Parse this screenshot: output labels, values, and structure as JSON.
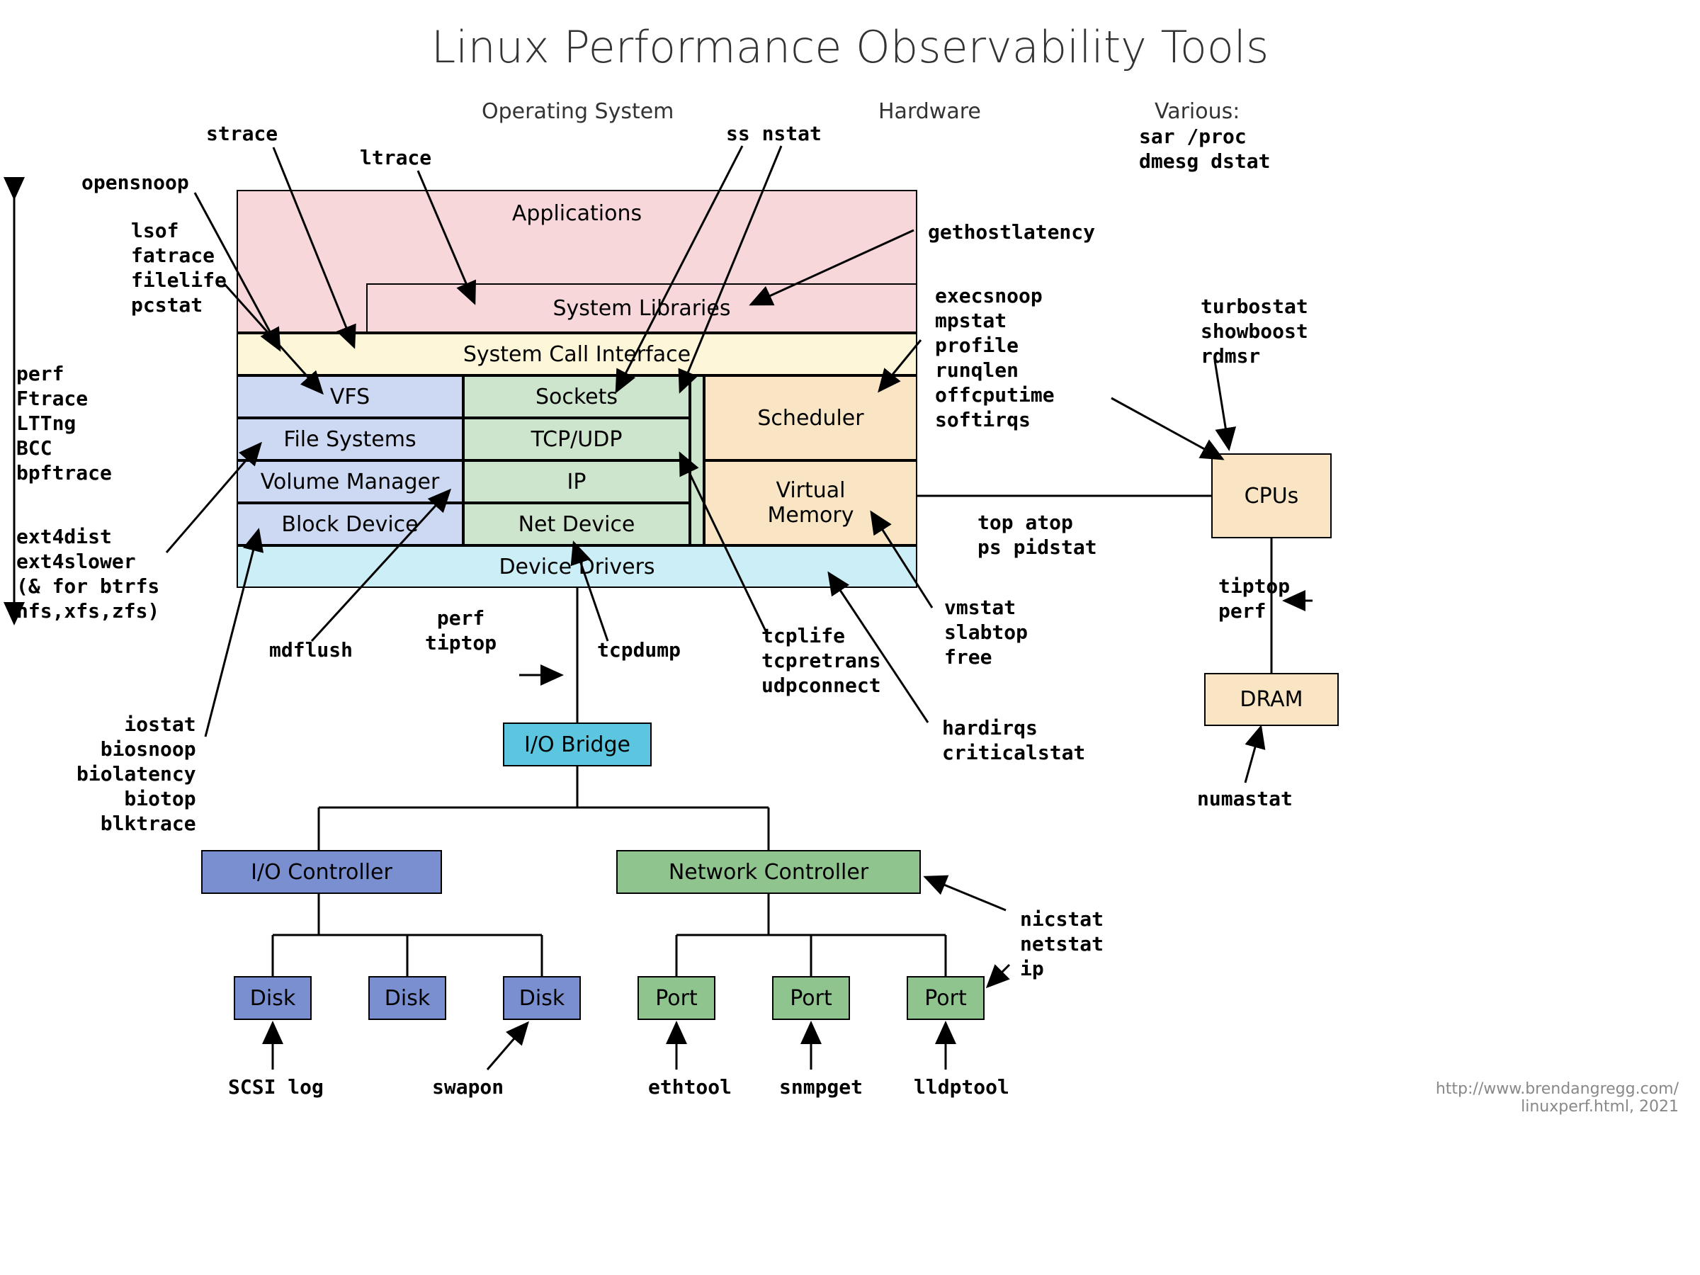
{
  "title": "Linux Performance Observability Tools",
  "section_os": "Operating System",
  "section_hw": "Hardware",
  "section_various": "Various:",
  "boxes": {
    "applications": "Applications",
    "syslibs": "System Libraries",
    "syscall": "System Call Interface",
    "vfs": "VFS",
    "sockets": "Sockets",
    "filesystems": "File Systems",
    "tcpudp": "TCP/UDP",
    "scheduler": "Scheduler",
    "volmgr": "Volume Manager",
    "ip": "IP",
    "virtmem": "Virtual\nMemory",
    "blockdev": "Block Device",
    "netdev": "Net Device",
    "drivers": "Device Drivers",
    "iobridge": "I/O Bridge",
    "ioctrl": "I/O Controller",
    "netctrl": "Network Controller",
    "disk": "Disk",
    "port": "Port",
    "cpus": "CPUs",
    "dram": "DRAM"
  },
  "tools": {
    "various": "sar /proc\ndmesg dstat",
    "strace": "strace",
    "ltrace": "ltrace",
    "ss_nstat": "ss nstat",
    "opensnoop": "opensnoop",
    "lsof_group": "lsof\nfatrace\nfilelife\npcstat",
    "perf_group": "perf\nFtrace\nLTTng\nBCC\nbpftrace",
    "ext4_group": "ext4dist\next4slower\n(& for btrfs\nnfs,xfs,zfs)",
    "iostat_group": "iostat\nbiosnoop\nbiolatency\nbiotop\nblktrace",
    "mdflush": "mdflush",
    "perf_tiptop": "perf\ntiptop",
    "tcpdump": "tcpdump",
    "tcplife_group": "tcplife\ntcpretrans\nudpconnect",
    "gethostlatency": "gethostlatency",
    "execsnoop_group": "execsnoop\nmpstat\nprofile\nrunqlen\noffcputime\nsoftirqs",
    "top_group": "top atop\nps pidstat",
    "vmstat_group": "vmstat\nslabtop\nfree",
    "hardirqs_group": "hardirqs\ncriticalstat",
    "turbostat_group": "turbostat\nshowboost\nrdmsr",
    "tiptop_perf": "tiptop\nperf",
    "numastat": "numastat",
    "nicstat_group": "nicstat\nnetstat\nip",
    "scsilog": "SCSI log",
    "swapon": "swapon",
    "ethtool": "ethtool",
    "snmpget": "snmpget",
    "lldptool": "lldptool"
  },
  "attribution": "http://www.brendangregg.com/\nlinuxperf.html, 2021"
}
